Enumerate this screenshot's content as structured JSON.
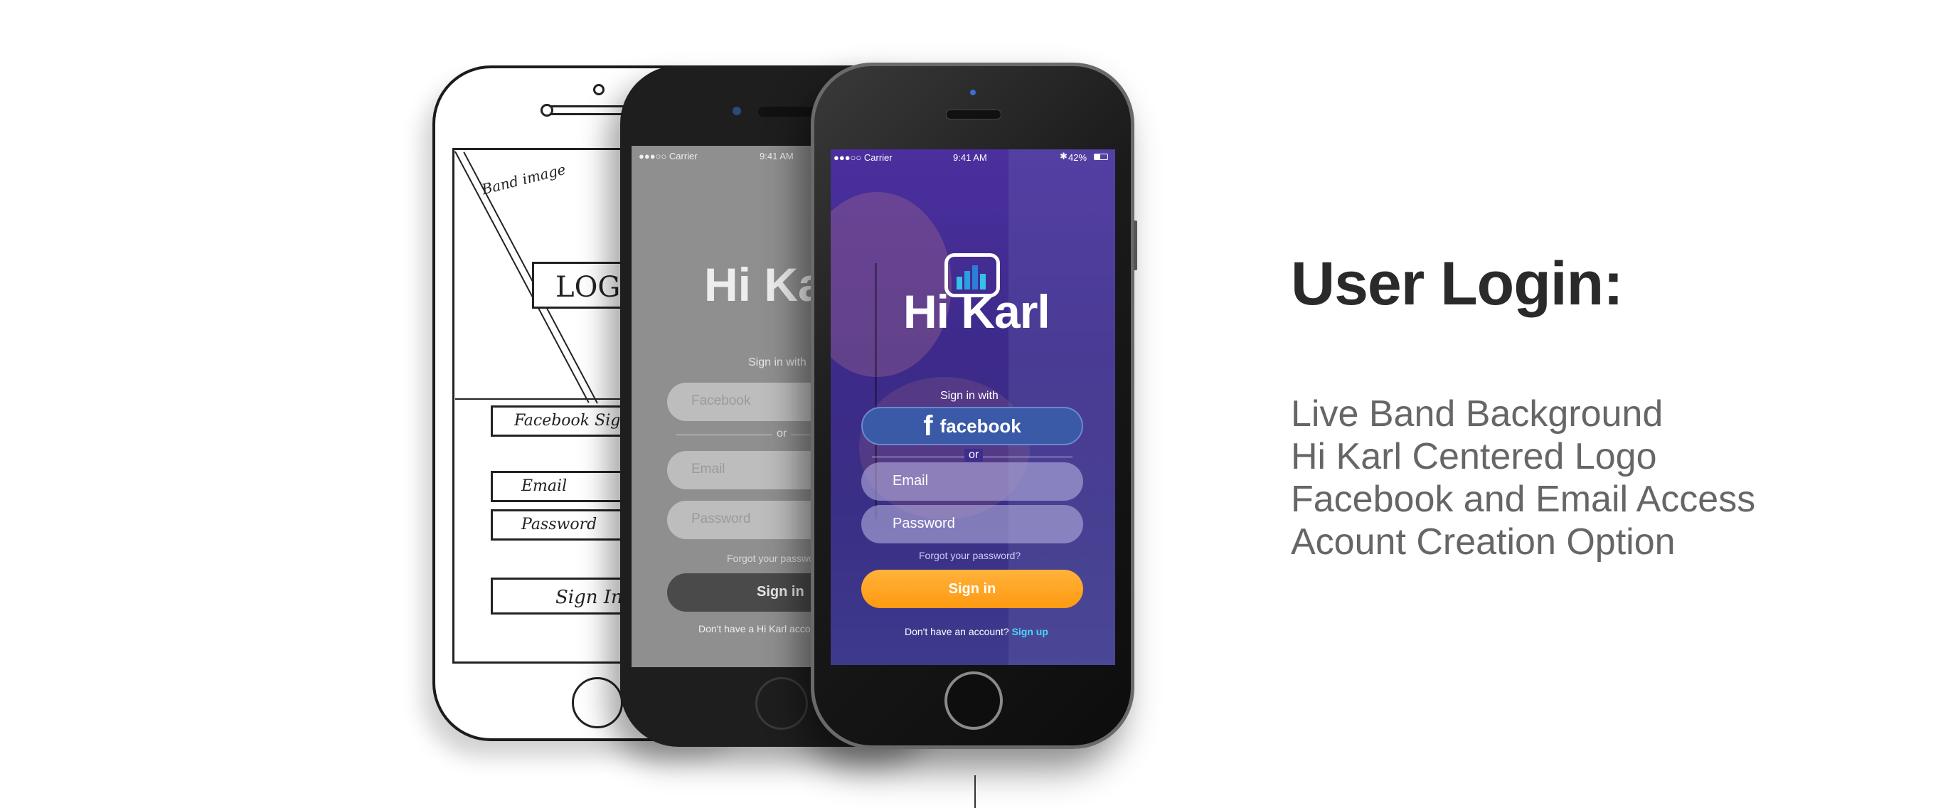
{
  "colors": {
    "accent_orange": "#ff9f1c",
    "facebook_blue": "#3a5aa8",
    "screen_purple": "#3f2c8e",
    "signup_link": "#4dd3ff"
  },
  "sketch": {
    "image_note": "Band image",
    "logo": "LOGO",
    "facebook": "Facebook Sign",
    "email": "Email",
    "password": "Password",
    "signin": "Sign In"
  },
  "grey_mock": {
    "carrier": "●●●○○ Carrier",
    "time": "9:41 AM",
    "logo": "Hi Karl",
    "sign_in_with": "Sign in with",
    "facebook_placeholder": "Facebook",
    "or": "or",
    "email_placeholder": "Email",
    "password_placeholder": "Password",
    "forgot": "Forgot your password?",
    "signin": "Sign in",
    "no_account": "Don't have a Hi Karl account?"
  },
  "app": {
    "carrier": "●●●○○ Carrier",
    "time": "9:41 AM",
    "battery": "42%",
    "logo": "Hi Karl",
    "sign_in_with": "Sign in with",
    "facebook_label": "facebook",
    "or": "or",
    "email_placeholder": "Email",
    "password_placeholder": "Password",
    "forgot": "Forgot your password?",
    "signin": "Sign in",
    "no_account": "Don't have an account?",
    "signup": "Sign up"
  },
  "panel": {
    "heading": "User Login:",
    "features": [
      "Live Band Background",
      "Hi Karl Centered Logo",
      "Facebook and Email Access",
      "Acount Creation Option"
    ]
  }
}
